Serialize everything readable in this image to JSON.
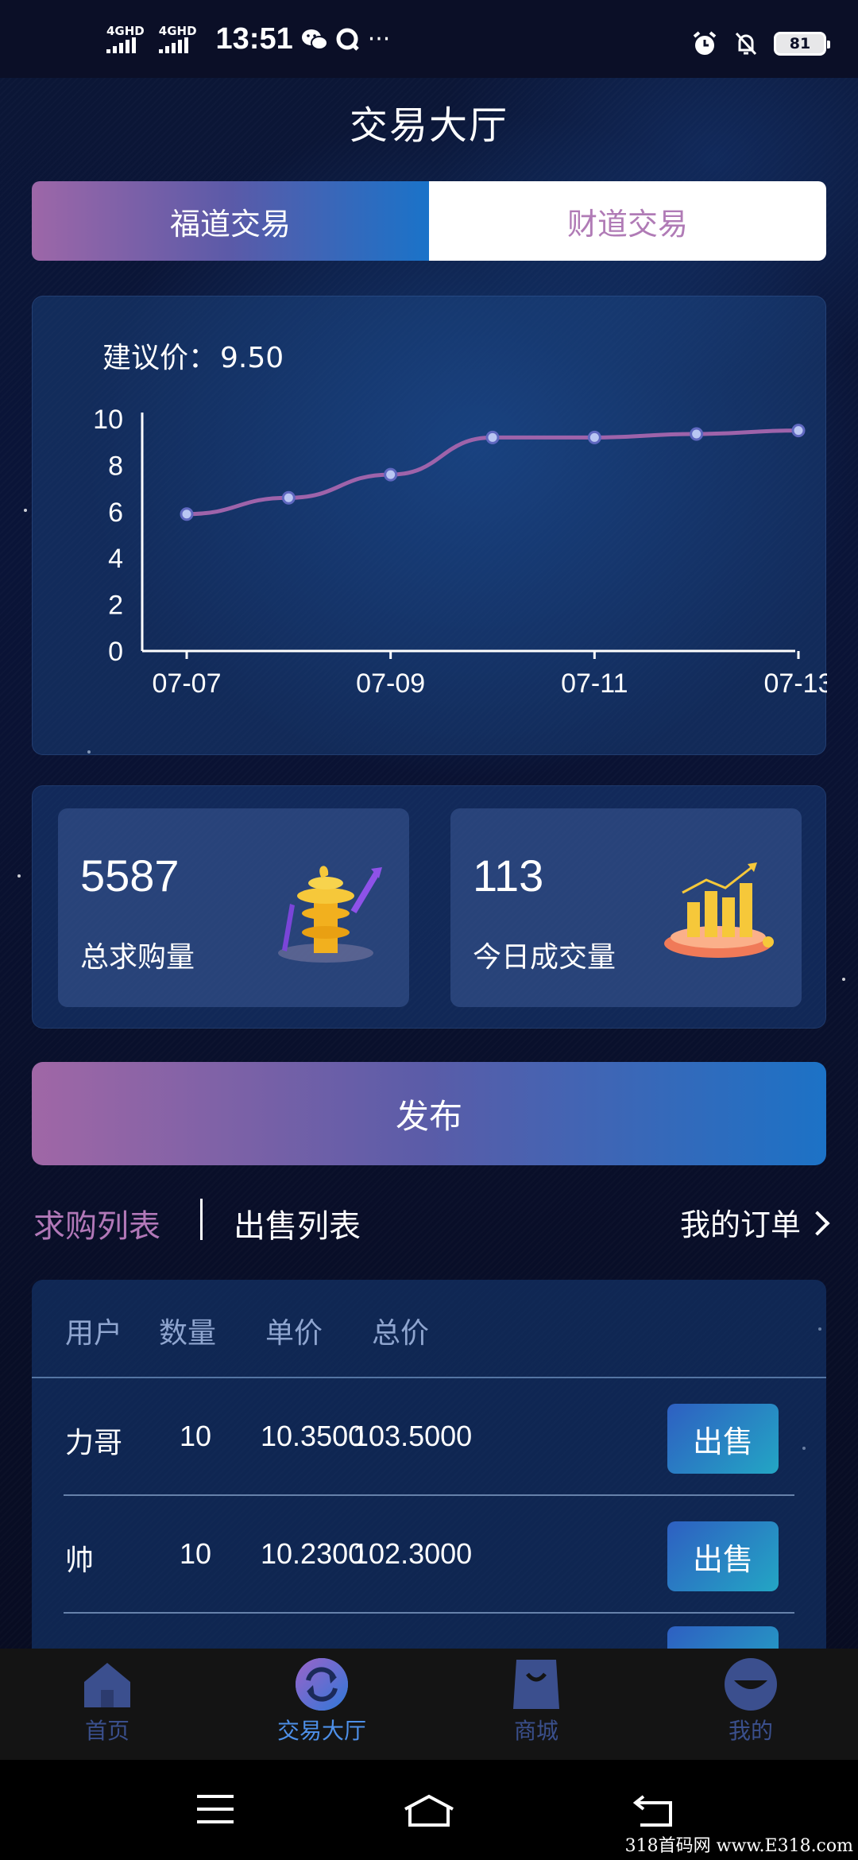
{
  "status_bar": {
    "signal1_label": "4GHD",
    "signal2_label": "4GHD",
    "time": "13:51",
    "more": "···",
    "battery": "81"
  },
  "page": {
    "title": "交易大厅"
  },
  "segments": {
    "active": "福道交易",
    "inactive": "财道交易"
  },
  "chart_card": {
    "price_label": "建议价：",
    "price_value": "9.50"
  },
  "chart_data": {
    "type": "line",
    "x": [
      "07-07",
      "07-08",
      "07-09",
      "07-10",
      "07-11",
      "07-12",
      "07-13"
    ],
    "values": [
      5.9,
      6.6,
      7.6,
      9.2,
      9.2,
      9.35,
      9.5
    ],
    "xticks": [
      "07-07",
      "07-09",
      "07-11",
      "07-13"
    ],
    "yticks": [
      0,
      2,
      4,
      6,
      8,
      10
    ],
    "ylim": [
      0,
      10
    ],
    "color": "#9e63aa",
    "title": "",
    "xlabel": "",
    "ylabel": ""
  },
  "stats": [
    {
      "value": "5587",
      "label": "总求购量"
    },
    {
      "value": "113",
      "label": "今日成交量"
    }
  ],
  "publish_label": "发布",
  "list_tabs": {
    "buy": "求购列表",
    "sell": "出售列表",
    "my_orders": "我的订单"
  },
  "table": {
    "headers": [
      "用户",
      "数量",
      "单价",
      "总价"
    ],
    "rows": [
      {
        "user": "力哥",
        "qty": "10",
        "price": "10.3500",
        "total": "103.5000",
        "action": "出售"
      },
      {
        "user": "帅",
        "qty": "10",
        "price": "10.2300",
        "total": "102.3000",
        "action": "出售"
      }
    ]
  },
  "nav": [
    {
      "label": "首页",
      "icon": "home-icon"
    },
    {
      "label": "交易大厅",
      "icon": "exchange-icon"
    },
    {
      "label": "商城",
      "icon": "shop-bag-icon"
    },
    {
      "label": "我的",
      "icon": "profile-smile-icon"
    }
  ],
  "colors": {
    "accent_purple": "#b278b8",
    "accent_blue": "#1c72c6",
    "nav_active": "#4d8fe8"
  }
}
